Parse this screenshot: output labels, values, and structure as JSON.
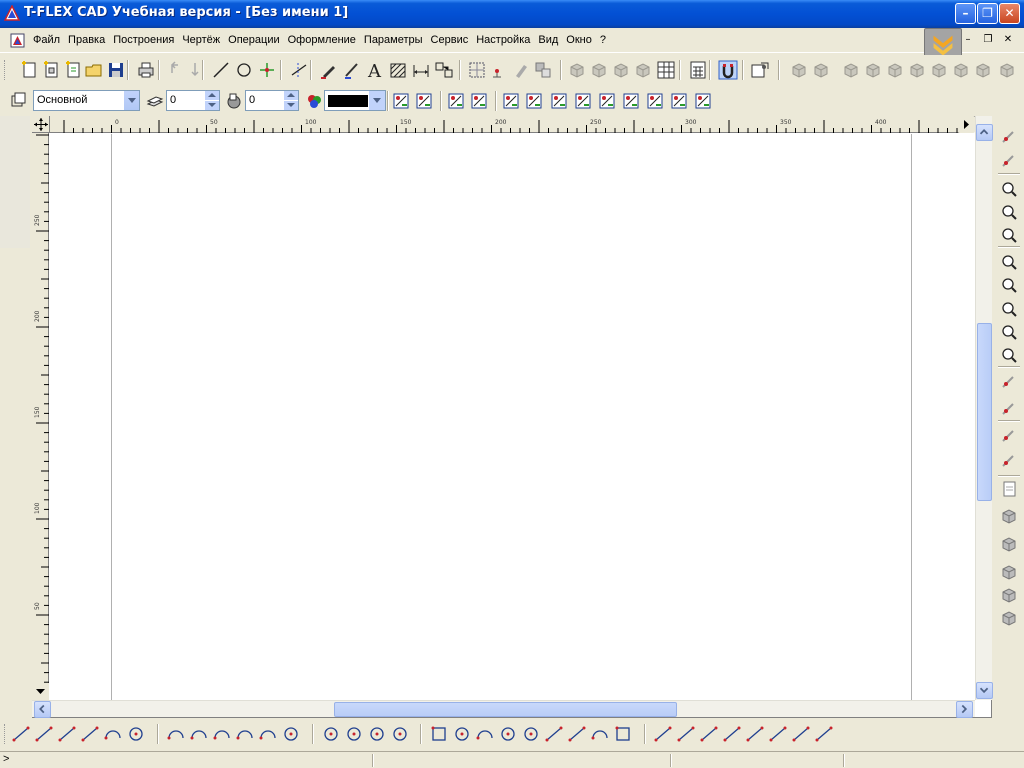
{
  "window": {
    "title": "T-FLEX CAD Учебная версия - [Без имени 1]",
    "buttons": {
      "minimize": "–",
      "restore": "❐",
      "close": "✕"
    }
  },
  "menu": {
    "items": [
      "Файл",
      "Правка",
      "Построения",
      "Чертёж",
      "Операции",
      "Оформление",
      "Параметры",
      "Сервис",
      "Настройка",
      "Вид",
      "Окно",
      "?"
    ],
    "mdi": {
      "minimize": "–",
      "restore": "❐",
      "close": "✕"
    }
  },
  "properties": {
    "layer": "Основной",
    "level": "0",
    "priority": "0",
    "color_swatch": "#000000"
  },
  "rulers": {
    "horizontal_labels": [
      "0",
      "50",
      "100",
      "150",
      "200",
      "250",
      "300",
      "350",
      "400"
    ],
    "vertical_labels": [
      "250",
      "200",
      "150",
      "100",
      "50"
    ]
  },
  "status": {
    "prompt": ">"
  },
  "colors": {
    "titlebar": "#0350d4",
    "chrome": "#ece9d8",
    "scroll_thumb": "#c1d3fb",
    "accent_red": "#c8232c",
    "accent_green": "#2a9a2a",
    "accent_blue": "#2a4bd6"
  },
  "icons": {
    "toolbar1": [
      "new-doc-icon",
      "new-doc-3d-icon",
      "new-doc-template-icon",
      "open-icon",
      "save-icon",
      "print-icon",
      "undo-icon",
      "redo-icon",
      "line-icon",
      "circle-icon",
      "node-icon",
      "trim-icon",
      "pen-icon",
      "graphic-line-icon",
      "text-icon",
      "hatch-icon",
      "dimension-icon",
      "fragment-icon",
      "view-icon",
      "snap-icon",
      "edit-icon",
      "copy-icon",
      "variables-icon",
      "calculator-icon",
      "magnet-icon",
      "options-icon"
    ],
    "right": [
      "edit-elements-icon",
      "check-icon",
      "zoom-in-icon",
      "zoom-window-icon",
      "zoom-all-icon",
      "zoom-icon",
      "zoom-prev-icon",
      "zoom-1to1-icon",
      "zoom-out-icon",
      "zoom-select-icon",
      "rotate-icon",
      "screen-icon",
      "snap-points-icon",
      "pick-icon",
      "page-icon",
      "pages-icon",
      "3d-view-icon",
      "3d-copy-icon",
      "3d-model-icon",
      "3d-box-icon"
    ],
    "bottom": [
      "line-tool-icon",
      "cross-lines-icon",
      "angle-line-icon",
      "parallel-line-icon",
      "arc-tangent-icon",
      "circle-tangent-icon",
      "arc-1-icon",
      "arc-2-icon",
      "arc-3-icon",
      "arc-4-icon",
      "arc-5-icon",
      "circles-icon",
      "circle-center-icon",
      "circle-tool-icon",
      "circle-3pt-icon",
      "circle-2-icon",
      "rect-icon",
      "ellipse-icon",
      "arc-6-icon",
      "ellipse-2-icon",
      "ellipse-3-icon",
      "spline-icon",
      "polygon-icon",
      "arch-icon",
      "shape-icon",
      "node-tool-icon",
      "bend-icon",
      "angle-icon",
      "dim-icon",
      "base-icon",
      "segment-icon",
      "polyline-icon",
      "curve-icon"
    ]
  }
}
